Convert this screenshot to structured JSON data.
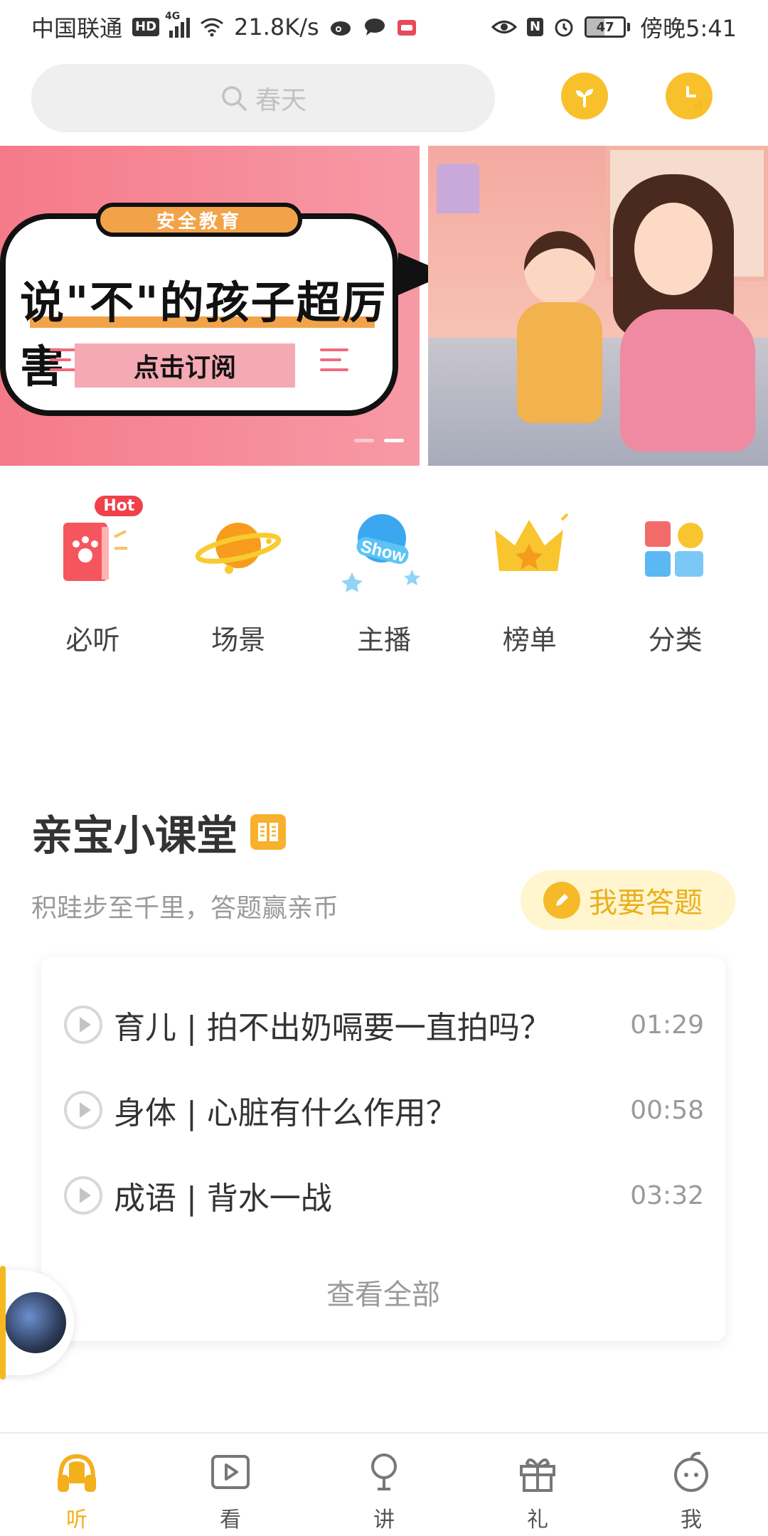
{
  "status_bar": {
    "carrier": "中国联通",
    "hd": "HD",
    "network": "4G",
    "speed": "21.8K/s",
    "nfc": "N",
    "battery": "47",
    "battery_level": 0.47,
    "time": "傍晚5:41"
  },
  "search": {
    "placeholder": "春天"
  },
  "banner": {
    "tag": "安全教育",
    "title": "说\"不\"的孩子超厉害",
    "cta": "点击订阅",
    "pages": 2,
    "active_page": 2
  },
  "categories": [
    {
      "label": "必听",
      "icon": "book-paw-icon",
      "badge": "Hot"
    },
    {
      "label": "场景",
      "icon": "planet-icon"
    },
    {
      "label": "主播",
      "icon": "show-microphone-icon"
    },
    {
      "label": "榜单",
      "icon": "crown-icon"
    },
    {
      "label": "分类",
      "icon": "blocks-icon"
    }
  ],
  "section": {
    "title": "亲宝小课堂",
    "subtitle": "积跬步至千里，答题赢亲币",
    "answer_button": "我要答题"
  },
  "lessons": [
    {
      "title": "育儿 | 拍不出奶嗝要一直拍吗？",
      "duration": "01:29"
    },
    {
      "title": "身体 | 心脏有什么作用？",
      "duration": "00:58"
    },
    {
      "title": "成语 | 背水一战",
      "duration": "03:32"
    }
  ],
  "view_all": "查看全部",
  "bottom_nav": [
    {
      "label": "听",
      "icon": "headphones-icon",
      "active": true
    },
    {
      "label": "看",
      "icon": "video-play-icon",
      "active": false
    },
    {
      "label": "讲",
      "icon": "microphone-icon",
      "active": false
    },
    {
      "label": "礼",
      "icon": "gift-icon",
      "active": false
    },
    {
      "label": "我",
      "icon": "profile-icon",
      "active": false
    }
  ],
  "colors": {
    "accent": "#f5b823",
    "banner_pink": "#f57a89",
    "hot_red": "#f0404a",
    "muted_text": "#9a9a9a"
  }
}
